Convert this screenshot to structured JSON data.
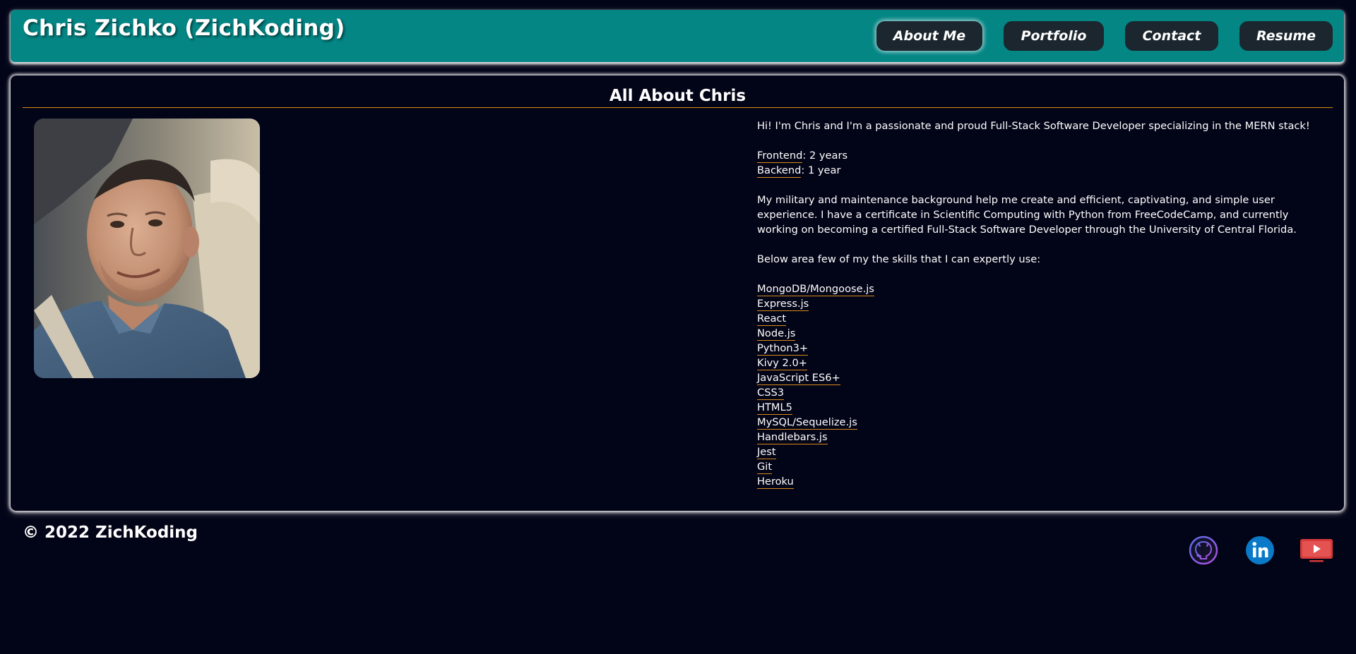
{
  "header": {
    "title": "Chris Zichko (ZichKoding)",
    "nav": [
      {
        "label": "About Me",
        "active": true
      },
      {
        "label": "Portfolio",
        "active": false
      },
      {
        "label": "Contact",
        "active": false
      },
      {
        "label": "Resume",
        "active": false
      }
    ]
  },
  "about": {
    "heading": "All About Chris",
    "intro": "Hi! I'm Chris and I'm a passionate and proud Full-Stack Software Developer specializing in the MERN stack!",
    "frontend_label": "Frontend",
    "frontend_value": ": 2 years",
    "backend_label": "Backend",
    "backend_value": ": 1 year",
    "background": "My military and maintenance background help me create and efficient, captivating, and simple user experience. I have a certificate in Scientific Computing with Python from FreeCodeCamp, and currently working on becoming a certified Full-Stack Software Developer through the University of Central Florida.",
    "skills_intro": "Below area few of my the skills that I can expertly use:",
    "skills": [
      "MongoDB/Mongoose.js",
      "Express.js",
      "React",
      "Node.js",
      "Python3+",
      "Kivy 2.0+",
      "JavaScript ES6+",
      "CSS3",
      "HTML5",
      "MySQL/Sequelize.js",
      "Handlebars.js",
      "Jest",
      "Git",
      "Heroku"
    ]
  },
  "footer": {
    "copyright": "© 2022 ZichKoding",
    "social_icons": [
      "github-icon",
      "linkedin-icon",
      "youtube-icon"
    ]
  },
  "colors": {
    "background": "#020417",
    "header": "#048685",
    "nav_button": "#1b262e",
    "accent_underline": "#d98a1c",
    "linkedin": "#0a7ac8",
    "youtube": "#d63a3a"
  }
}
